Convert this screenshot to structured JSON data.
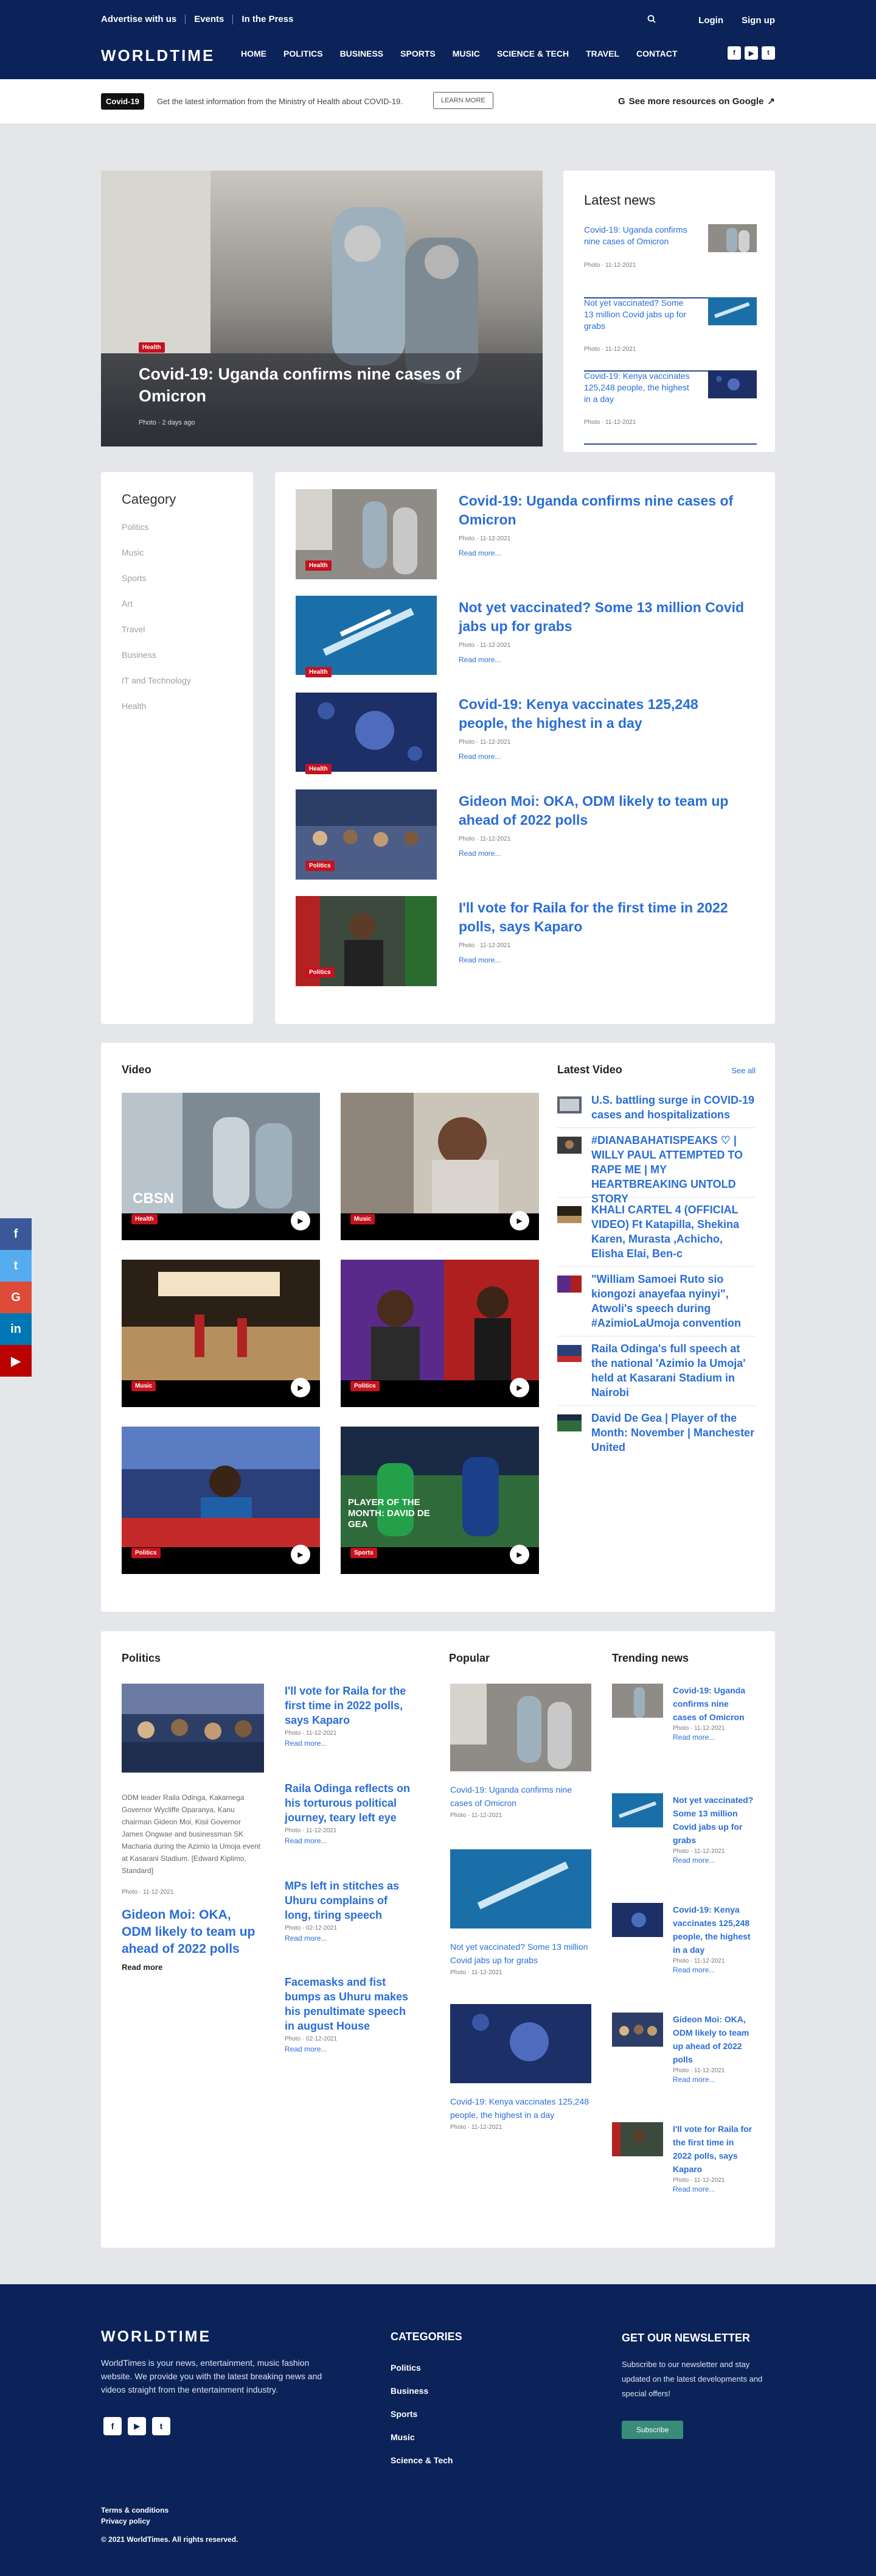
{
  "topbar": {
    "links": [
      "Advertise with us",
      "Events",
      "In the Press"
    ],
    "login": "Login",
    "signup": "Sign up",
    "search_icon": "search-icon"
  },
  "nav": {
    "logo": "WORLDTIME",
    "items": [
      "HOME",
      "POLITICS",
      "BUSINESS",
      "SPORTS",
      "MUSIC",
      "SCIENCE & TECH",
      "TRAVEL",
      "CONTACT"
    ],
    "social": [
      "f",
      "▶",
      "t"
    ]
  },
  "covid": {
    "tag": "Covid-19",
    "text": "Get the latest information from the Ministry of Health about COVID-19.",
    "learn_more": "LEARN MORE",
    "google": "See more resources on Google"
  },
  "hero": {
    "tag": "Health",
    "title": "Covid-19: Uganda confirms nine cases of Omicron",
    "meta": "Photo · 2 days ago"
  },
  "latest_news": {
    "heading": "Latest news",
    "items": [
      {
        "title": "Covid-19: Uganda confirms nine cases of Omicron",
        "meta": "Photo · 11-12-2021"
      },
      {
        "title": "Not yet vaccinated? Some 13 million Covid jabs up for grabs",
        "meta": "Photo · 11-12-2021"
      },
      {
        "title": "Covid-19: Kenya vaccinates 125,248 people, the highest in a day",
        "meta": "Photo · 11-12-2021"
      }
    ]
  },
  "category": {
    "heading": "Category",
    "items": [
      "Politics",
      "Music",
      "Sports",
      "Art",
      "Travel",
      "Business",
      "IT and Technology",
      "Health"
    ]
  },
  "articles": [
    {
      "tag": "Health",
      "title": "Covid-19: Uganda confirms nine cases of Omicron",
      "meta": "Photo · 11-12-2021",
      "read": "Read more..."
    },
    {
      "tag": "Health",
      "title": "Not yet vaccinated? Some 13 million Covid jabs up for grabs",
      "meta": "Photo · 11-12-2021",
      "read": "Read more..."
    },
    {
      "tag": "Health",
      "title": "Covid-19: Kenya vaccinates 125,248 people, the highest in a day",
      "meta": "Photo · 11-12-2021",
      "read": "Read more..."
    },
    {
      "tag": "Politics",
      "title": "Gideon Moi: OKA, ODM likely to team up ahead of 2022 polls",
      "meta": "Photo · 11-12-2021",
      "read": "Read more..."
    },
    {
      "tag": "Politics",
      "title": "I'll vote for Raila for the first time in 2022 polls, says Kaparo",
      "meta": "Photo · 11-12-2021",
      "read": "Read more..."
    }
  ],
  "video": {
    "heading": "Video",
    "tiles": [
      {
        "tag": "Health",
        "overlay": "CBSN"
      },
      {
        "tag": "Music",
        "overlay": ""
      },
      {
        "tag": "Music",
        "overlay": ""
      },
      {
        "tag": "Politics",
        "overlay": ""
      },
      {
        "tag": "Politics",
        "overlay": ""
      },
      {
        "tag": "Sports",
        "overlay": "PLAYER OF THE MONTH: DAVID DE GEA"
      }
    ]
  },
  "latest_video": {
    "heading": "Latest Video",
    "see_all": "See all",
    "items": [
      "U.S. battling surge in COVID-19 cases and hospitalizations",
      "#DIANABAHATISPEAKS ♡ | WILLY PAUL ATTEMPTED TO RAPE ME | MY HEARTBREAKING UNTOLD STORY",
      "KHALI CARTEL 4 (OFFICIAL VIDEO) Ft Katapilla, Shekina Karen, Murasta ,Achicho, Elisha Elai, Ben-c",
      "\"William Samoei Ruto sio kiongozi anayefaa nyinyi\", Atwoli's speech during #AzimioLaUmoja convention",
      "Raila Odinga's full speech at the national 'Azimio la Umoja' held at Kasarani Stadium in Nairobi",
      "David De Gea | Player of the Month: November | Manchester United"
    ]
  },
  "politics": {
    "heading": "Politics",
    "caption": "ODM leader Raila Odinga, Kakamega Governor Wycliffe Oparanya, Kanu chairman Gideon Moi, Kisii Governor James Ongwae and businessman SK Macharia during the Azimio la Umoja event at Kasarani Stadium. [Edward Kiplimo, Standard]",
    "main_meta": "Photo · 11-12-2021",
    "main_title": "Gideon Moi: OKA, ODM likely to team up ahead of 2022 polls",
    "main_read": "Read more",
    "list": [
      {
        "title": "I'll vote for Raila for the first time in 2022 polls, says Kaparo",
        "meta": "Photo · 11-12-2021",
        "read": "Read more..."
      },
      {
        "title": "Raila Odinga reflects on his torturous political journey, teary left eye",
        "meta": "Photo · 11-12-2021",
        "read": "Read more..."
      },
      {
        "title": "MPs left in stitches as Uhuru complains of long, tiring speech",
        "meta": "Photo · 02-12-2021",
        "read": "Read more..."
      },
      {
        "title": "Facemasks and fist bumps as Uhuru makes his penultimate speech in august House",
        "meta": "Photo · 02-12-2021",
        "read": "Read more..."
      }
    ]
  },
  "popular": {
    "heading": "Popular",
    "items": [
      {
        "title": "Covid-19: Uganda confirms nine cases of Omicron",
        "meta": "Photo · 11-12-2021"
      },
      {
        "title": "Not yet vaccinated? Some 13 million Covid jabs up for grabs",
        "meta": "Photo · 11-12-2021"
      },
      {
        "title": "Covid-19: Kenya vaccinates 125,248 people, the highest in a day",
        "meta": "Photo · 11-12-2021"
      }
    ]
  },
  "trending": {
    "heading": "Trending news",
    "items": [
      {
        "title": "Covid-19: Uganda confirms nine cases of Omicron",
        "meta": "Photo · 11-12-2021",
        "read": "Read more..."
      },
      {
        "title": "Not yet vaccinated? Some 13 million Covid jabs up for grabs",
        "meta": "Photo · 11-12-2021",
        "read": "Read more..."
      },
      {
        "title": "Covid-19: Kenya vaccinates 125,248 people, the highest in a day",
        "meta": "Photo · 11-12-2021",
        "read": "Read more..."
      },
      {
        "title": "Gideon Moi: OKA, ODM likely to team up ahead of 2022 polls",
        "meta": "Photo · 11-12-2021",
        "read": "Read more..."
      },
      {
        "title": "I'll vote for Raila for the first time in 2022 polls, says Kaparo",
        "meta": "Photo · 11-12-2021",
        "read": "Read more..."
      }
    ]
  },
  "side_social": [
    "f",
    "t",
    "G",
    "in",
    "▶"
  ],
  "footer": {
    "logo": "WORLDTIME",
    "about": "WorldTimes is your news, entertainment, music fashion website. We provide you with the latest breaking news and videos straight from the entertainment industry.",
    "categories_heading": "CATEGORIES",
    "categories": [
      "Politics",
      "Business",
      "Sports",
      "Music",
      "Science & Tech"
    ],
    "newsletter_heading": "GET OUR NEWSLETTER",
    "newsletter_text": "Subscribe to our newsletter and stay updated on the latest developments and special offers!",
    "subscribe": "Subscribe",
    "terms": "Terms & conditions",
    "privacy": "Privacy policy",
    "copyright": "© 2021 WorldTimes. All rights reserved."
  }
}
